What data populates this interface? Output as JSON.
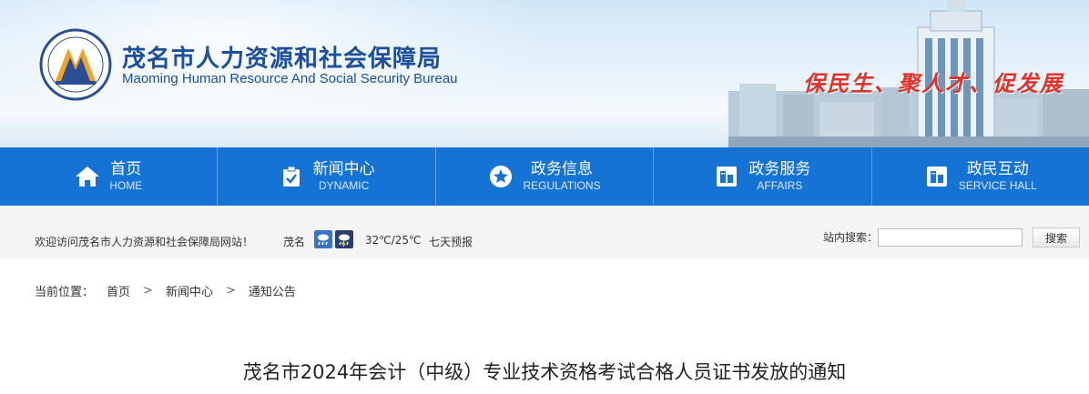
{
  "header": {
    "title": "茂名市人力资源和社会保障局",
    "subtitle": "Maoming Human Resource And Social Security Bureau",
    "slogan": "保民生、聚人才、促发展"
  },
  "nav": {
    "items": [
      {
        "cn": "首页",
        "en": "HOME",
        "icon": "home-icon"
      },
      {
        "cn": "新闻中心",
        "en": "DYNAMIC",
        "icon": "clipboard-icon"
      },
      {
        "cn": "政务信息",
        "en": "REGULATIONS",
        "icon": "star-icon"
      },
      {
        "cn": "政务服务",
        "en": "AFFAIRS",
        "icon": "building-icon"
      },
      {
        "cn": "政民互动",
        "en": "SERVICE HALL",
        "icon": "building-icon"
      }
    ]
  },
  "infobar": {
    "welcome": "欢迎访问茂名市人力资源和社会保障局网站！",
    "city": "茂名",
    "temperature": "32℃/25℃",
    "forecast_link": "七天预报",
    "weather_icons": [
      "rain-icon",
      "storm-icon"
    ],
    "search_label": "站内搜索：",
    "search_value": "",
    "search_button": "搜索"
  },
  "breadcrumb": {
    "label": "当前位置：",
    "items": [
      "首页",
      "新闻中心",
      "通知公告"
    ],
    "separator": ">"
  },
  "article": {
    "title": "茂名市2024年会计（中级）专业技术资格考试合格人员证书发放的通知"
  },
  "colors": {
    "nav_bg": "#1673d6",
    "title_blue": "#1c4f9c",
    "slogan_red": "#e4322b",
    "infobar_bg": "#f4f4f4"
  }
}
